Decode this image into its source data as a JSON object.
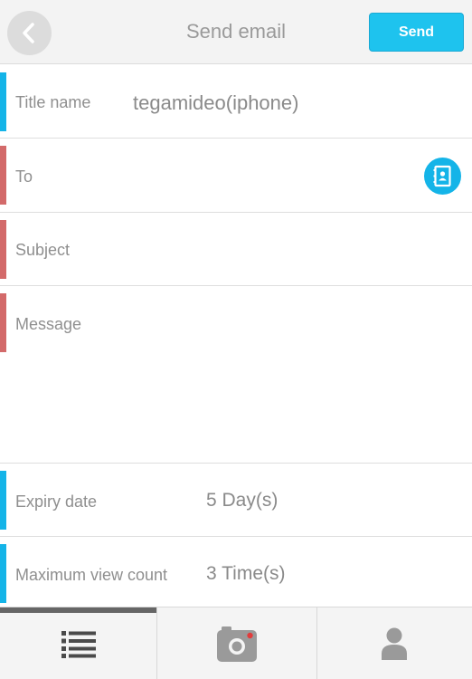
{
  "header": {
    "title": "Send email",
    "send_label": "Send",
    "back_icon": "chevron-left-icon"
  },
  "form": {
    "title_name": {
      "label": "Title name",
      "value": "tegamideo(iphone)"
    },
    "to": {
      "label": "To",
      "value": "",
      "icon": "address-book-icon"
    },
    "subject": {
      "label": "Subject",
      "value": ""
    },
    "message": {
      "label": "Message",
      "value": ""
    },
    "expiry": {
      "label": "Expiry date",
      "value": "5 Day(s)"
    },
    "view_count": {
      "label": "Maximum view count",
      "value": "3 Time(s)"
    }
  },
  "colors": {
    "accent": "#1ec3ee",
    "required_bar": "#d36a6a",
    "optional_bar": "#14b4e8"
  },
  "tabs": [
    {
      "name": "list",
      "icon": "list-icon",
      "active": true
    },
    {
      "name": "camera",
      "icon": "camera-icon",
      "active": false
    },
    {
      "name": "profile",
      "icon": "user-icon",
      "active": false
    }
  ]
}
